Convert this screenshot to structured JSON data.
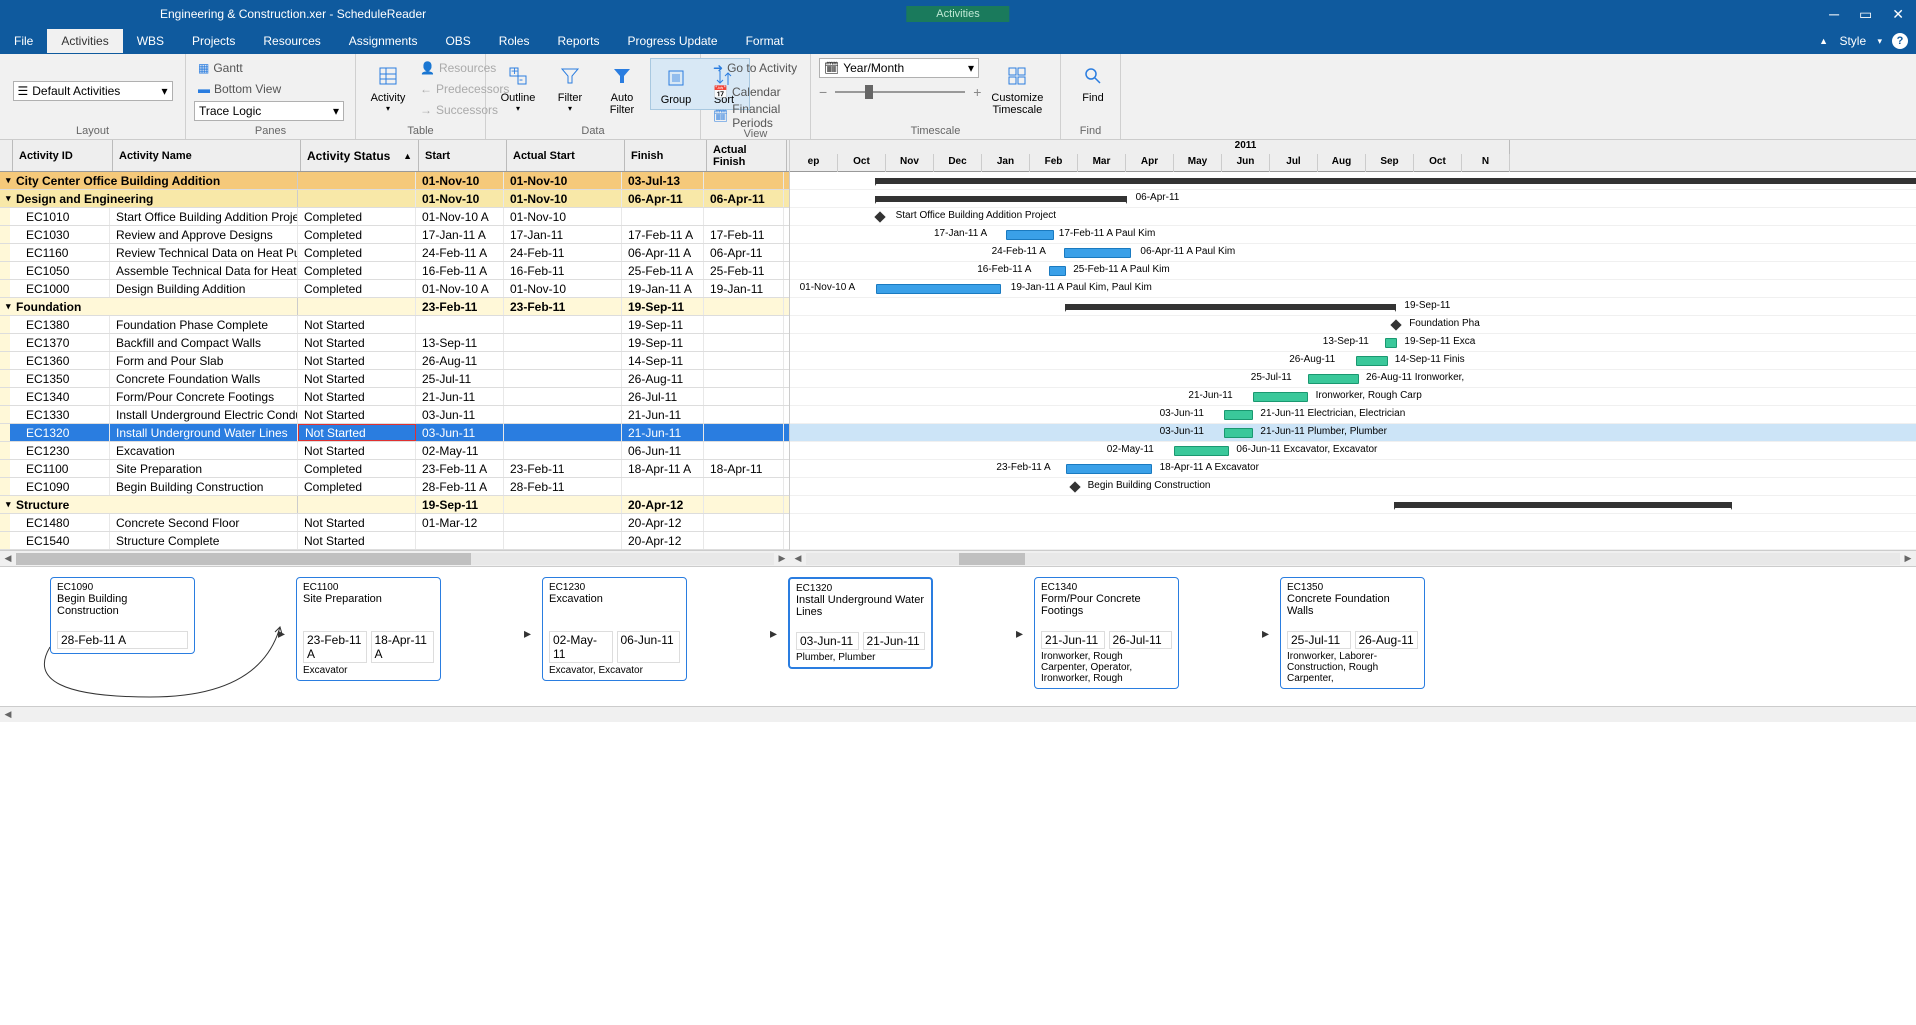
{
  "title": "Engineering & Construction.xer - ScheduleReader",
  "context_tab": "Activities",
  "menu": [
    "File",
    "Activities",
    "WBS",
    "Projects",
    "Resources",
    "Assignments",
    "OBS",
    "Roles",
    "Reports",
    "Progress Update",
    "Format"
  ],
  "menu_active": "Activities",
  "style_label": "Style",
  "ribbon": {
    "layout": {
      "select": "Default Activities",
      "label": "Layout"
    },
    "panes": {
      "gantt": "Gantt",
      "bottom": "Bottom View",
      "trace": "Trace Logic",
      "label": "Panes"
    },
    "table": {
      "activity": "Activity",
      "resources": "Resources",
      "predecessors": "Predecessors",
      "successors": "Successors",
      "label": "Table"
    },
    "data": {
      "outline": "Outline",
      "filter": "Filter",
      "autofilter": "Auto\nFilter",
      "group": "Group",
      "sort": "Sort",
      "label": "Data"
    },
    "view": {
      "goto": "Go to Activity",
      "calendar": "Calendar",
      "financial": "Financial Periods",
      "label": "View"
    },
    "timescale": {
      "select": "Year/Month",
      "customize": "Customize\nTimescale",
      "label": "Timescale"
    },
    "find": {
      "find": "Find",
      "label": "Find"
    }
  },
  "columns": {
    "id": "Activity ID",
    "name": "Activity Name",
    "status": "Activity Status",
    "start": "Start",
    "astart": "Actual Start",
    "finish": "Finish",
    "afinish": "Actual Finish"
  },
  "months": [
    "ep",
    "Oct",
    "Nov",
    "Dec",
    "Jan",
    "Feb",
    "Mar",
    "Apr",
    "May",
    "Jun",
    "Jul",
    "Aug",
    "Sep",
    "Oct",
    "N"
  ],
  "year": "2011",
  "rows": [
    {
      "type": "band",
      "level": 0,
      "name": "City Center Office Building Addition",
      "start": "01-Nov-10",
      "astart": "01-Nov-10",
      "finish": "03-Jul-13"
    },
    {
      "type": "band",
      "level": 1,
      "name": "Design and Engineering",
      "start": "01-Nov-10",
      "astart": "01-Nov-10",
      "finish": "06-Apr-11",
      "afinish": "06-Apr-11"
    },
    {
      "type": "act",
      "id": "EC1010",
      "name": "Start Office Building Addition Project",
      "status": "Completed",
      "start": "01-Nov-10 A",
      "astart": "01-Nov-10"
    },
    {
      "type": "act",
      "id": "EC1030",
      "name": "Review and Approve Designs",
      "status": "Completed",
      "start": "17-Jan-11 A",
      "astart": "17-Jan-11",
      "finish": "17-Feb-11 A",
      "afinish": "17-Feb-11"
    },
    {
      "type": "act",
      "id": "EC1160",
      "name": "Review Technical Data on Heat Pumps",
      "status": "Completed",
      "start": "24-Feb-11 A",
      "astart": "24-Feb-11",
      "finish": "06-Apr-11 A",
      "afinish": "06-Apr-11"
    },
    {
      "type": "act",
      "id": "EC1050",
      "name": "Assemble Technical Data for Heat Pum",
      "status": "Completed",
      "start": "16-Feb-11 A",
      "astart": "16-Feb-11",
      "finish": "25-Feb-11 A",
      "afinish": "25-Feb-11"
    },
    {
      "type": "act",
      "id": "EC1000",
      "name": "Design Building Addition",
      "status": "Completed",
      "start": "01-Nov-10 A",
      "astart": "01-Nov-10",
      "finish": "19-Jan-11 A",
      "afinish": "19-Jan-11"
    },
    {
      "type": "band",
      "level": 2,
      "name": "Foundation",
      "start": "23-Feb-11",
      "astart": "23-Feb-11",
      "finish": "19-Sep-11"
    },
    {
      "type": "act",
      "id": "EC1380",
      "name": "Foundation Phase Complete",
      "status": "Not Started",
      "finish": "19-Sep-11"
    },
    {
      "type": "act",
      "id": "EC1370",
      "name": "Backfill and Compact Walls",
      "status": "Not Started",
      "start": "13-Sep-11",
      "finish": "19-Sep-11"
    },
    {
      "type": "act",
      "id": "EC1360",
      "name": "Form and Pour Slab",
      "status": "Not Started",
      "start": "26-Aug-11",
      "finish": "14-Sep-11"
    },
    {
      "type": "act",
      "id": "EC1350",
      "name": "Concrete Foundation Walls",
      "status": "Not Started",
      "start": "25-Jul-11",
      "finish": "26-Aug-11"
    },
    {
      "type": "act",
      "id": "EC1340",
      "name": "Form/Pour Concrete Footings",
      "status": "Not Started",
      "start": "21-Jun-11",
      "finish": "26-Jul-11"
    },
    {
      "type": "act",
      "id": "EC1330",
      "name": "Install Underground Electric Conduit",
      "status": "Not Started",
      "start": "03-Jun-11",
      "finish": "21-Jun-11"
    },
    {
      "type": "act",
      "id": "EC1320",
      "name": "Install Underground Water Lines",
      "status": "Not Started",
      "start": "03-Jun-11",
      "finish": "21-Jun-11",
      "selected": true
    },
    {
      "type": "act",
      "id": "EC1230",
      "name": "Excavation",
      "status": "Not Started",
      "start": "02-May-11",
      "finish": "06-Jun-11"
    },
    {
      "type": "act",
      "id": "EC1100",
      "name": "Site Preparation",
      "status": "Completed",
      "start": "23-Feb-11 A",
      "astart": "23-Feb-11",
      "finish": "18-Apr-11 A",
      "afinish": "18-Apr-11"
    },
    {
      "type": "act",
      "id": "EC1090",
      "name": "Begin Building Construction",
      "status": "Completed",
      "start": "28-Feb-11 A",
      "astart": "28-Feb-11"
    },
    {
      "type": "band",
      "level": 2,
      "name": "Structure",
      "start": "19-Sep-11",
      "finish": "20-Apr-12"
    },
    {
      "type": "act",
      "id": "EC1480",
      "name": "Concrete Second Floor",
      "status": "Not Started",
      "start": "01-Mar-12",
      "finish": "20-Apr-12"
    },
    {
      "type": "act",
      "id": "EC1540",
      "name": "Structure Complete",
      "status": "Not Started",
      "finish": "20-Apr-12"
    }
  ],
  "gantt_labels": {
    "r1_right": "06-Apr-11",
    "r2_right": "Start Office Building Addition Project",
    "r3_left": "17-Jan-11 A",
    "r3_right": "17-Feb-11 A   Paul Kim",
    "r4_left": "24-Feb-11 A",
    "r4_right": "06-Apr-11 A   Paul Kim",
    "r5_left": "16-Feb-11 A",
    "r5_right": "25-Feb-11 A   Paul Kim",
    "r6_left": "01-Nov-10 A",
    "r6_right": "19-Jan-11 A   Paul Kim, Paul Kim",
    "r7_right": "19-Sep-11",
    "r8_right": "Foundation Pha",
    "r9_left": "13-Sep-11",
    "r9_right": "19-Sep-11   Exca",
    "r10_left": "26-Aug-11",
    "r10_right": "14-Sep-11   Finis",
    "r11_left": "25-Jul-11",
    "r11_right": "26-Aug-11   Ironworker,",
    "r12_left": "21-Jun-11",
    "r12_right": "Ironworker, Rough Carp",
    "r13_left": "03-Jun-11",
    "r13_right": "21-Jun-11   Electrician, Electrician",
    "r14_left": "03-Jun-11",
    "r14_right": "21-Jun-11   Plumber, Plumber",
    "r15_left": "02-May-11",
    "r15_right": "06-Jun-11   Excavator, Excavator",
    "r16_left": "23-Feb-11 A",
    "r16_right": "18-Apr-11 A   Excavator",
    "r17_right": "Begin Building Construction"
  },
  "trace_nodes": [
    {
      "id": "EC1090",
      "name": "Begin Building Construction",
      "d1": "28-Feb-11 A",
      "d2": "",
      "res": ""
    },
    {
      "id": "EC1100",
      "name": "Site Preparation",
      "d1": "23-Feb-11 A",
      "d2": "18-Apr-11 A",
      "res": "Excavator"
    },
    {
      "id": "EC1230",
      "name": "Excavation",
      "d1": "02-May-11",
      "d2": "06-Jun-11",
      "res": "Excavator, Excavator"
    },
    {
      "id": "EC1320",
      "name": "Install Underground Water Lines",
      "d1": "03-Jun-11",
      "d2": "21-Jun-11",
      "res": "Plumber, Plumber",
      "selected": true
    },
    {
      "id": "EC1340",
      "name": "Form/Pour Concrete Footings",
      "d1": "21-Jun-11",
      "d2": "26-Jul-11",
      "res": "Ironworker, Rough Carpenter, Operator, Ironworker, Rough"
    },
    {
      "id": "EC1350",
      "name": "Concrete Foundation Walls",
      "d1": "25-Jul-11",
      "d2": "26-Aug-11",
      "res": "Ironworker, Laborer-Construction, Rough Carpenter,"
    }
  ]
}
